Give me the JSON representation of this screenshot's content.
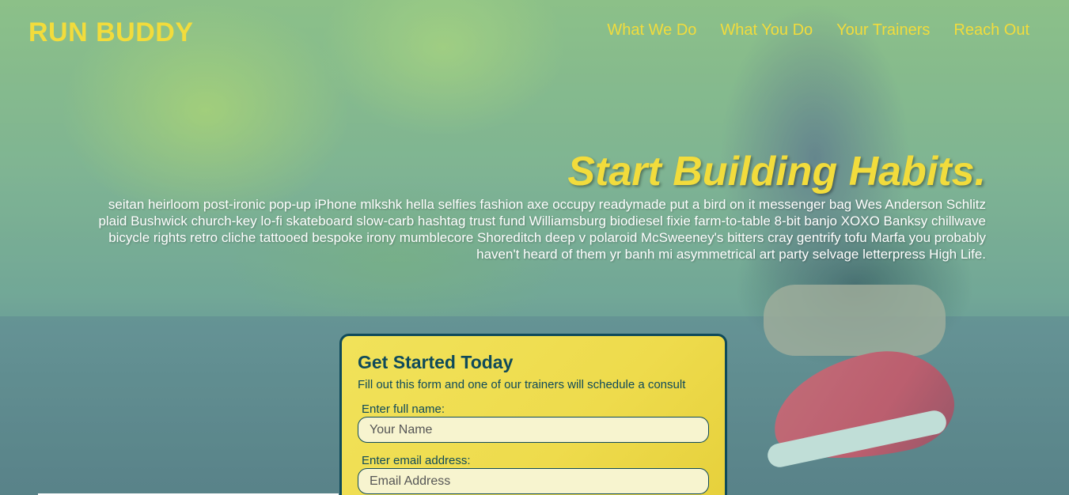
{
  "header": {
    "logo": "RUN BUDDY",
    "nav": [
      "What We Do",
      "What You Do",
      "Your Trainers",
      "Reach Out"
    ]
  },
  "hero": {
    "title": "Start Building Habits.",
    "body": "seitan heirloom post-ironic pop-up iPhone mlkshk hella selfies fashion axe occupy readymade put a bird on it messenger bag Wes Anderson Schlitz plaid Bushwick church-key lo-fi skateboard slow-carb hashtag trust fund Williamsburg biodiesel fixie farm-to-table 8-bit banjo XOXO Banksy chillwave bicycle rights retro cliche tattooed bespoke irony mumblecore Shoreditch deep v polaroid McSweeney's bitters cray gentrify tofu Marfa you probably haven't heard of them yr banh mi asymmetrical art party selvage letterpress High Life."
  },
  "form": {
    "title": "Get Started Today",
    "subtitle": "Fill out this form and one of our trainers will schedule a consult",
    "name_label": "Enter full name:",
    "name_placeholder": "Your Name",
    "email_label": "Enter email address:",
    "email_placeholder": "Email Address"
  },
  "colors": {
    "accent": "#f2dc3c",
    "dark": "#0f4a5a"
  }
}
